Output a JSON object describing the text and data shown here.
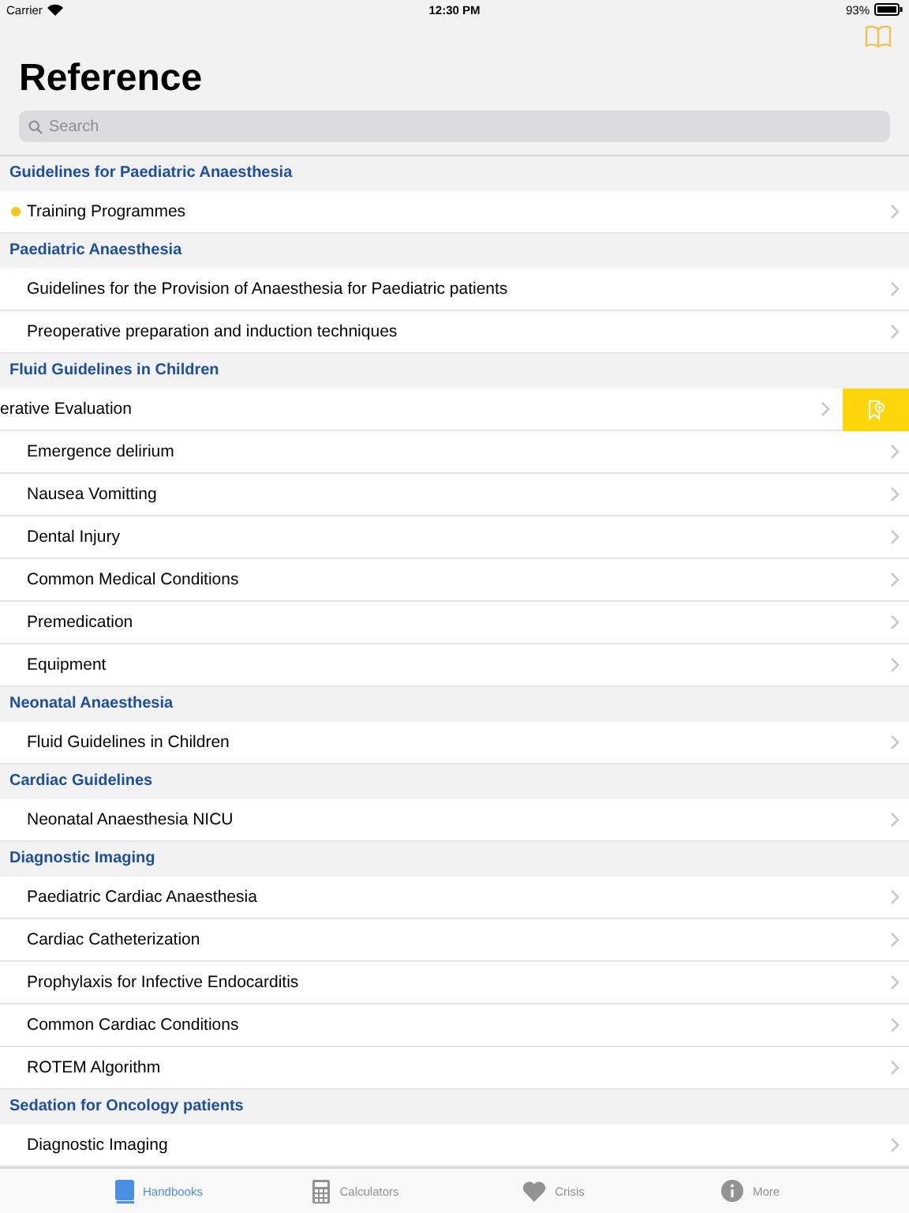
{
  "status_bar": {
    "carrier": "Carrier",
    "time": "12:30 PM",
    "battery": "93%"
  },
  "title": "Reference",
  "search": {
    "placeholder": "Search"
  },
  "sections": [
    {
      "header": "Guidelines for Paediatric Anaesthesia",
      "items": [
        {
          "label": "Training Programmes",
          "kind": "dot",
          "color": "#f5c518"
        }
      ]
    },
    {
      "header": "Paediatric Anaesthesia",
      "items": [
        {
          "label": "Guidelines for the Provision of Anaesthesia for Paediatric patients",
          "kind": "plain"
        },
        {
          "label": "Preoperative preparation and induction techniques",
          "kind": "plain"
        }
      ]
    },
    {
      "header": "Fluid Guidelines in Children",
      "items": [
        {
          "label": "erative Evaluation",
          "kind": "swiped"
        },
        {
          "label": "Emergence delirium",
          "kind": "plain"
        },
        {
          "label": "Nausea Vomitting",
          "kind": "plain"
        },
        {
          "label": "Dental Injury",
          "kind": "plain"
        },
        {
          "label": "Common Medical Conditions",
          "kind": "plain"
        },
        {
          "label": "Premedication",
          "kind": "plain"
        },
        {
          "label": "Equipment",
          "kind": "plain"
        }
      ]
    },
    {
      "header": "Neonatal Anaesthesia",
      "items": [
        {
          "label": "Fluid Guidelines in Children",
          "kind": "plain"
        }
      ]
    },
    {
      "header": "Cardiac Guidelines",
      "items": [
        {
          "label": "Neonatal Anaesthesia NICU",
          "kind": "plain"
        }
      ]
    },
    {
      "header": "Diagnostic Imaging",
      "items": [
        {
          "label": "Paediatric Cardiac Anaesthesia",
          "kind": "plain"
        },
        {
          "label": "Cardiac Catheterization",
          "kind": "plain"
        },
        {
          "label": "Prophylaxis for Infective Endocarditis",
          "kind": "plain"
        },
        {
          "label": "Common Cardiac Conditions",
          "kind": "plain"
        },
        {
          "label": "ROTEM Algorithm",
          "kind": "plain"
        }
      ]
    },
    {
      "header": "Sedation for Oncology patients",
      "items": [
        {
          "label": "Diagnostic Imaging",
          "kind": "plain"
        }
      ]
    }
  ],
  "tabs": [
    {
      "label": "Handbooks",
      "kind": "book",
      "selected": true
    },
    {
      "label": "Calculators",
      "kind": "calculator",
      "selected": false
    },
    {
      "label": "Crisis",
      "kind": "heart",
      "selected": false
    },
    {
      "label": "More",
      "kind": "info",
      "selected": false
    }
  ]
}
